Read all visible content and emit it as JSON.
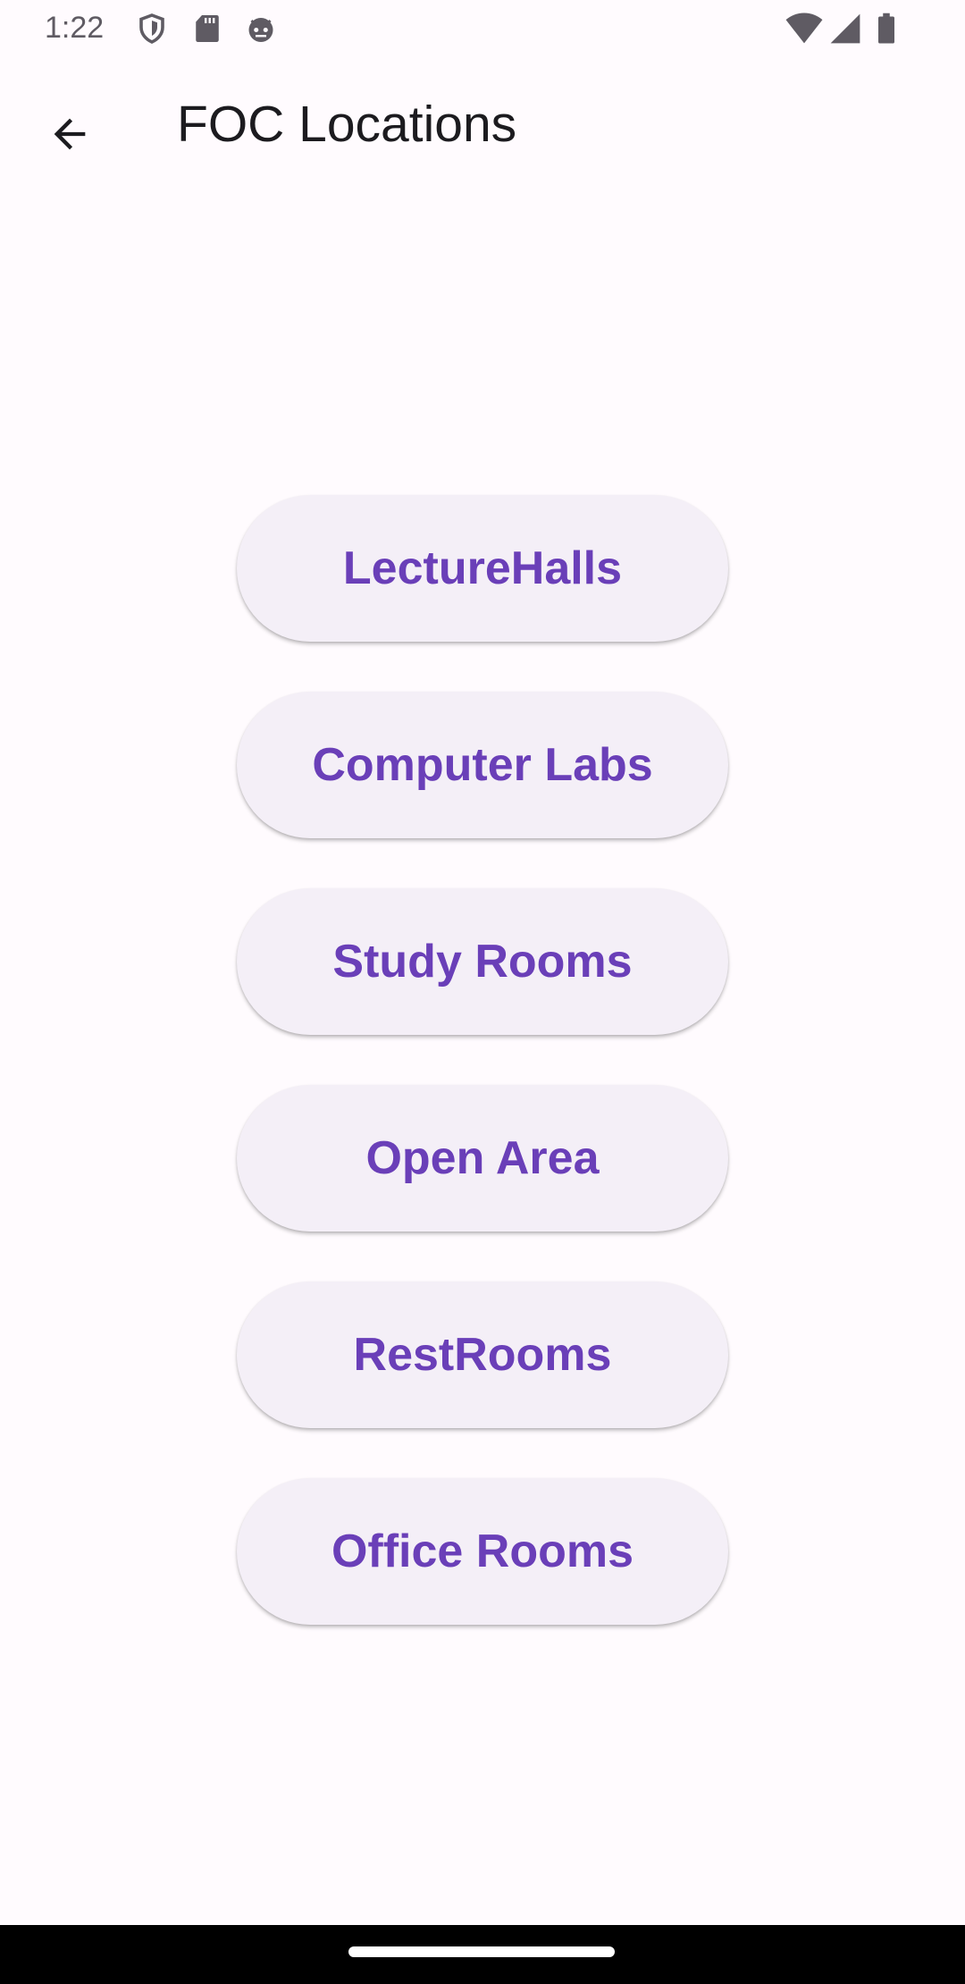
{
  "status_bar": {
    "time": "1:22",
    "left_icons": [
      "shield-icon",
      "sd-card-icon",
      "android-face-icon"
    ],
    "right_icons": [
      "wifi-icon",
      "cell-signal-icon",
      "battery-icon"
    ]
  },
  "app_bar": {
    "back_icon": "arrow-back-icon",
    "title": "FOC Locations"
  },
  "locations": [
    {
      "label": "LectureHalls"
    },
    {
      "label": "Computer Labs"
    },
    {
      "label": "Study Rooms"
    },
    {
      "label": "Open Area"
    },
    {
      "label": "RestRooms"
    },
    {
      "label": "Office Rooms"
    }
  ],
  "colors": {
    "background": "#fffbfe",
    "button_bg": "#f4eff7",
    "button_text": "#6a3fb8",
    "title_text": "#1c1b1f"
  }
}
